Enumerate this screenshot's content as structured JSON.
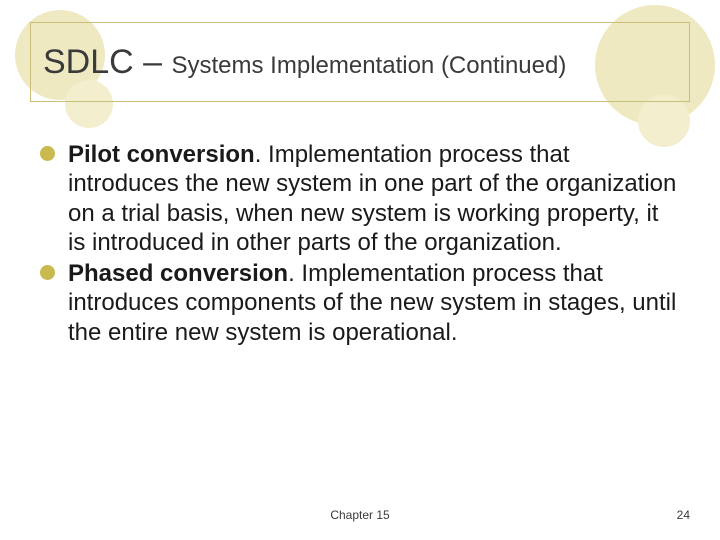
{
  "title": {
    "large": "SDLC – ",
    "small": "Systems Implementation (Continued)"
  },
  "bullets": [
    {
      "term": "Pilot conversion",
      "text": ". Implementation process that introduces the new system in one part of the organization on a trial basis, when new system is working property, it is introduced in other parts of the organization."
    },
    {
      "term": "Phased conversion",
      "text": ". Implementation process that introduces components of the new system in stages, until the entire new system is operational."
    }
  ],
  "footer": {
    "chapter": "Chapter 15",
    "page": "24"
  }
}
